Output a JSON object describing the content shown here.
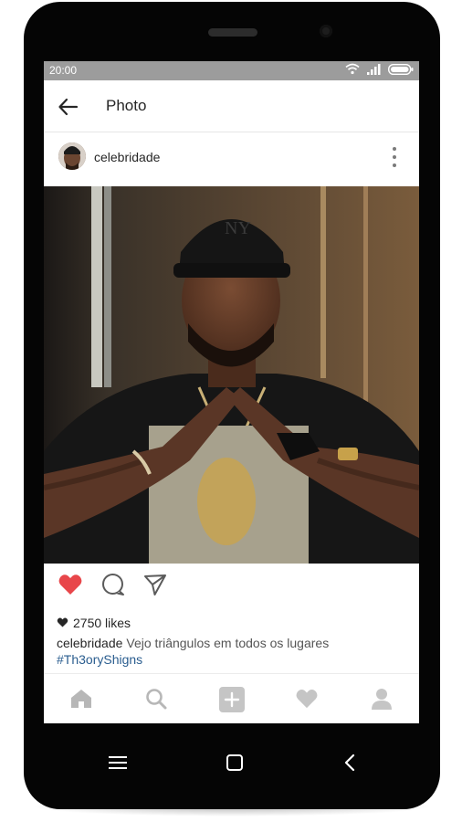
{
  "status": {
    "time": "20:00",
    "icons": [
      "wifi-icon",
      "signal-icon",
      "battery-icon"
    ]
  },
  "appbar": {
    "title": "Photo",
    "back_icon": "back-arrow-icon"
  },
  "post": {
    "username": "celebridade",
    "more_icon": "more-vertical-icon",
    "liked": true,
    "like_color": "#e8464a",
    "likes_text": "2750 likes",
    "caption_user": "celebridade",
    "caption_text": "Vejo triângulos em todos os lugares",
    "hashtag": "#Th3oryShigns"
  },
  "tabbar": {
    "items": [
      "home-icon",
      "search-icon",
      "add-icon",
      "heart-icon",
      "profile-icon"
    ]
  },
  "navbar": {
    "items": [
      "menu-icon",
      "home-square-icon",
      "back-chevron-icon"
    ]
  }
}
